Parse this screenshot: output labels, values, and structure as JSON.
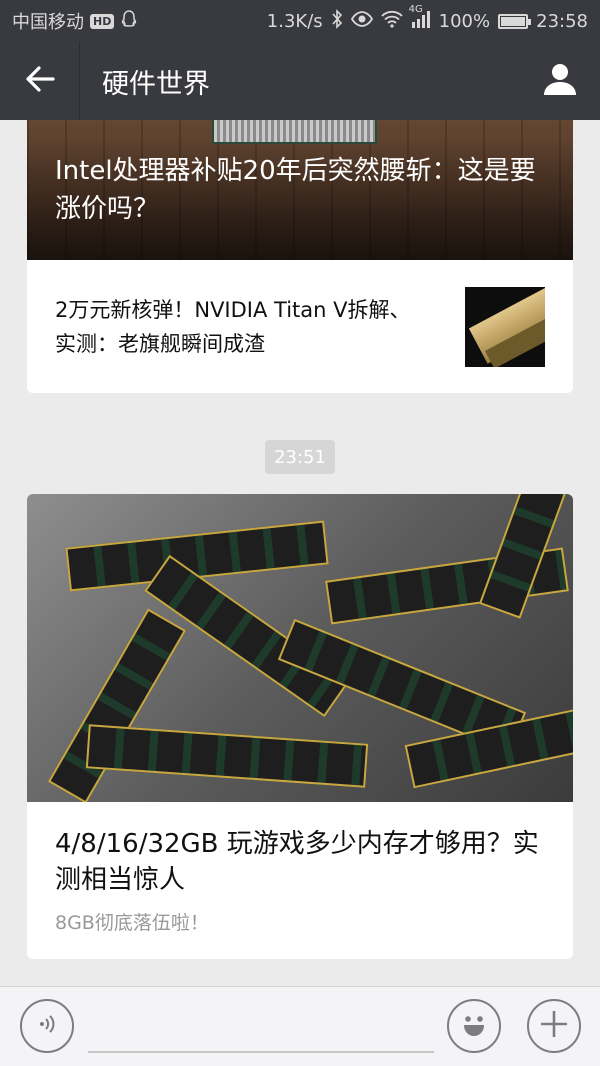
{
  "status_bar": {
    "carrier": "中国移动",
    "hd_badge": "HD",
    "network_speed": "1.3K/s",
    "network_type": "4G",
    "battery_percent": "100%",
    "battery_level": 1.0,
    "time": "23:58",
    "icons": [
      "qq-icon",
      "bluetooth-icon",
      "eye-icon",
      "wifi-icon",
      "signal-icon",
      "battery-icon"
    ]
  },
  "header": {
    "title": "硬件世界",
    "back_icon": "back-arrow-icon",
    "profile_icon": "profile-icon",
    "background": "#393a3f"
  },
  "messages": [
    {
      "hero_title": "Intel处理器补贴20年后突然腰斩：这是要涨价吗？",
      "sub_article_title": "2万元新核弹！NVIDIA Titan V拆解、实测：老旗舰瞬间成渣"
    },
    {
      "time": "23:51",
      "title": "4/8/16/32GB 玩游戏多少内存才够用？实测相当惊人",
      "subtitle": "8GB彻底落伍啦！"
    }
  ],
  "bottom_bar": {
    "voice_icon": "voice-icon",
    "emoji_icon": "emoji-icon",
    "plus_icon": "plus-icon"
  }
}
